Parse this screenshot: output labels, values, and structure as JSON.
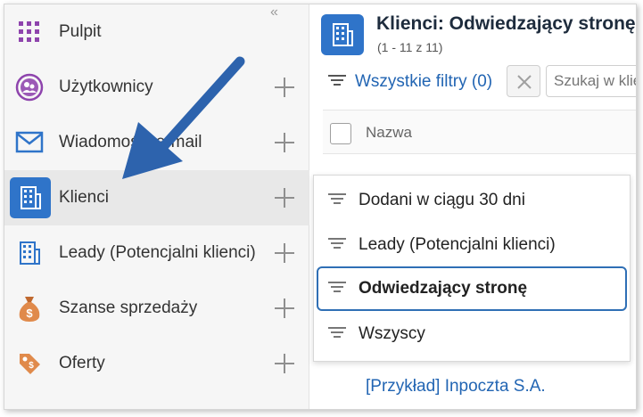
{
  "sidebar": {
    "items": [
      {
        "label": "Pulpit",
        "icon": "grid-icon"
      },
      {
        "label": "Użytkownicy",
        "icon": "users-icon"
      },
      {
        "label": "Wiadomości e-mail",
        "icon": "mail-icon"
      },
      {
        "label": "Klienci",
        "icon": "building-icon",
        "active": true
      },
      {
        "label": "Leady (Potencjalni klienci)",
        "icon": "building-outline-icon"
      },
      {
        "label": "Szanse sprzedaży",
        "icon": "money-bag-icon"
      },
      {
        "label": "Oferty",
        "icon": "tag-icon"
      }
    ],
    "collapse_glyph": "«"
  },
  "header": {
    "title": "Klienci: Odwiedzający stronę",
    "count": "(1 - 11 z 11)"
  },
  "filters": {
    "all_filters_label": "Wszystkie filtry (0)",
    "search_placeholder": "Szukaj w kliencie"
  },
  "table": {
    "column_name": "Nazwa",
    "visible_row": "[Przykład] Inpoczta S.A."
  },
  "dropdown": {
    "items": [
      {
        "label": "Dodani w ciągu 30 dni"
      },
      {
        "label": "Leady (Potencjalni klienci)"
      },
      {
        "label": "Odwiedzający stronę",
        "selected": true
      },
      {
        "label": "Wszyscy"
      }
    ]
  },
  "colors": {
    "accent": "#2f74c9",
    "link": "#2265b3",
    "arrow": "#2d63ad",
    "grid_icon": "#8e44ad"
  }
}
